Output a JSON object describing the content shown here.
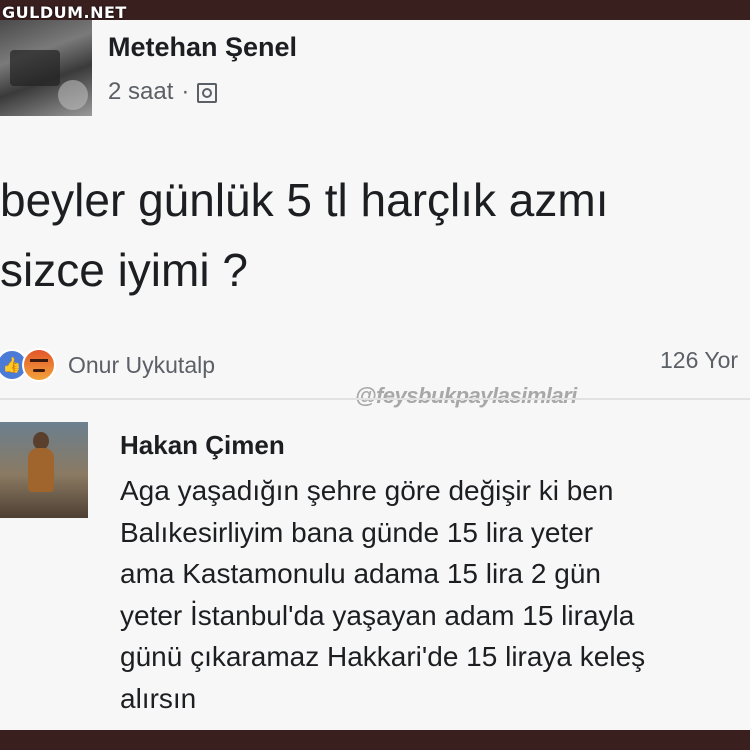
{
  "site_watermark": "GULDUM.NET",
  "post": {
    "author": "Metehan Şenel",
    "time": "2 saat",
    "separator": "·",
    "text_line1": "beyler günlük 5 tl harçlık azmı",
    "text_line2": "sizce iyimi ?"
  },
  "reactions": {
    "names": "Onur Uykutalp",
    "comment_count": "126 Yor",
    "icons": [
      "like-icon",
      "angry-icon"
    ]
  },
  "handle_watermark": "@feysbukpaylasimlari",
  "comment": {
    "author": "Hakan Çimen",
    "text": "Aga yaşadığın şehre göre değişir ki ben\nBalıkesirliyim bana günde 15 lira yeter\nama Kastamonulu adama 15 lira 2 gün\nyeter İstanbul'da yaşayan adam 15 lirayla\ngünü çıkaramaz Hakkari'de 15 liraya keleş\nalırsın"
  },
  "colors": {
    "frame": "#3a1f1f",
    "card": "#f7f7f7",
    "like_blue": "#4b7bd6",
    "angry_orange": "#e2562b"
  }
}
